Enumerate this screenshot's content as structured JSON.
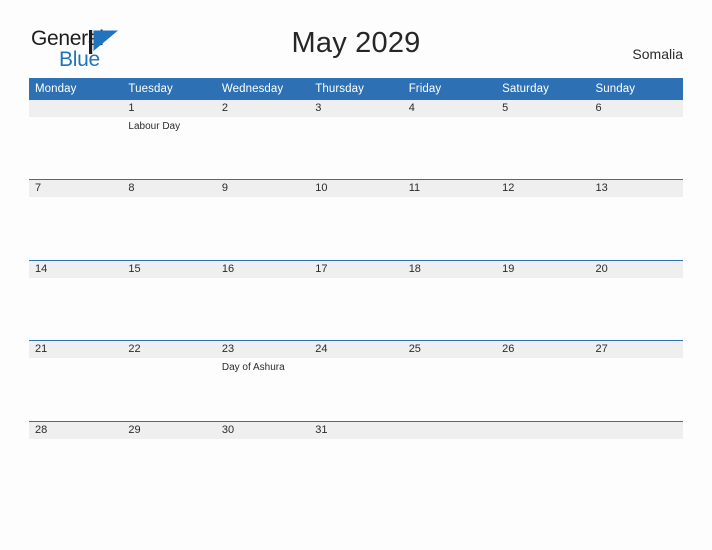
{
  "brand": {
    "name_part1": "General",
    "name_part2": "Blue",
    "accent_color": "#1f74bd",
    "flag_icon": "blue-triangle-flag-icon"
  },
  "header": {
    "title": "May 2029",
    "country": "Somalia"
  },
  "colors": {
    "header_blue": "#2d71b4",
    "row_divider_blue": "#2d71b4",
    "date_band_gray": "#efefef",
    "page_background": "#fdfdfd",
    "text": "#2b2b2b"
  },
  "calendar": {
    "weekdays": [
      "Monday",
      "Tuesday",
      "Wednesday",
      "Thursday",
      "Friday",
      "Saturday",
      "Sunday"
    ],
    "weeks": [
      [
        {
          "day": "",
          "event": ""
        },
        {
          "day": "1",
          "event": "Labour Day"
        },
        {
          "day": "2",
          "event": ""
        },
        {
          "day": "3",
          "event": ""
        },
        {
          "day": "4",
          "event": ""
        },
        {
          "day": "5",
          "event": ""
        },
        {
          "day": "6",
          "event": ""
        }
      ],
      [
        {
          "day": "7",
          "event": ""
        },
        {
          "day": "8",
          "event": ""
        },
        {
          "day": "9",
          "event": ""
        },
        {
          "day": "10",
          "event": ""
        },
        {
          "day": "11",
          "event": ""
        },
        {
          "day": "12",
          "event": ""
        },
        {
          "day": "13",
          "event": ""
        }
      ],
      [
        {
          "day": "14",
          "event": ""
        },
        {
          "day": "15",
          "event": ""
        },
        {
          "day": "16",
          "event": ""
        },
        {
          "day": "17",
          "event": ""
        },
        {
          "day": "18",
          "event": ""
        },
        {
          "day": "19",
          "event": ""
        },
        {
          "day": "20",
          "event": ""
        }
      ],
      [
        {
          "day": "21",
          "event": ""
        },
        {
          "day": "22",
          "event": ""
        },
        {
          "day": "23",
          "event": "Day of Ashura"
        },
        {
          "day": "24",
          "event": ""
        },
        {
          "day": "25",
          "event": ""
        },
        {
          "day": "26",
          "event": ""
        },
        {
          "day": "27",
          "event": ""
        }
      ],
      [
        {
          "day": "28",
          "event": ""
        },
        {
          "day": "29",
          "event": ""
        },
        {
          "day": "30",
          "event": ""
        },
        {
          "day": "31",
          "event": ""
        },
        {
          "day": "",
          "event": ""
        },
        {
          "day": "",
          "event": ""
        },
        {
          "day": "",
          "event": ""
        }
      ]
    ]
  }
}
